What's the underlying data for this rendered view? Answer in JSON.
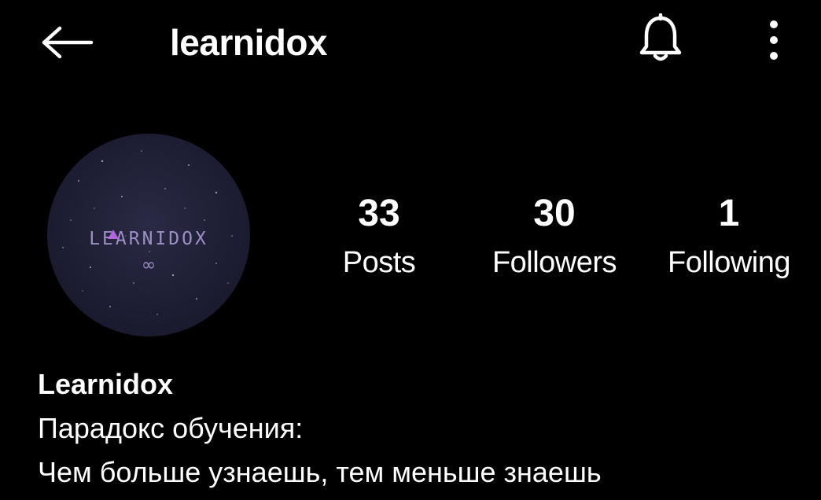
{
  "header": {
    "username": "learnidox",
    "back_icon": "arrow-left-icon",
    "notification_icon": "bell-icon",
    "more_icon": "more-vertical-icon"
  },
  "avatar": {
    "logo_text": "LEARNIDOX",
    "logo_symbol": "∞"
  },
  "stats": {
    "posts": {
      "count": "33",
      "label": "Posts"
    },
    "followers": {
      "count": "30",
      "label": "Followers"
    },
    "following": {
      "count": "1",
      "label": "Following"
    }
  },
  "bio": {
    "display_name": "Learnidox",
    "line1": "Парадокс обучения:",
    "line2": "Чем больше узнаешь, тем меньше знаешь"
  },
  "colors": {
    "background": "#000000",
    "text": "#ffffff",
    "logo_text": "#9d8fc4",
    "logo_accent": "#c06cf0",
    "avatar_bg": "#1d1d33"
  }
}
